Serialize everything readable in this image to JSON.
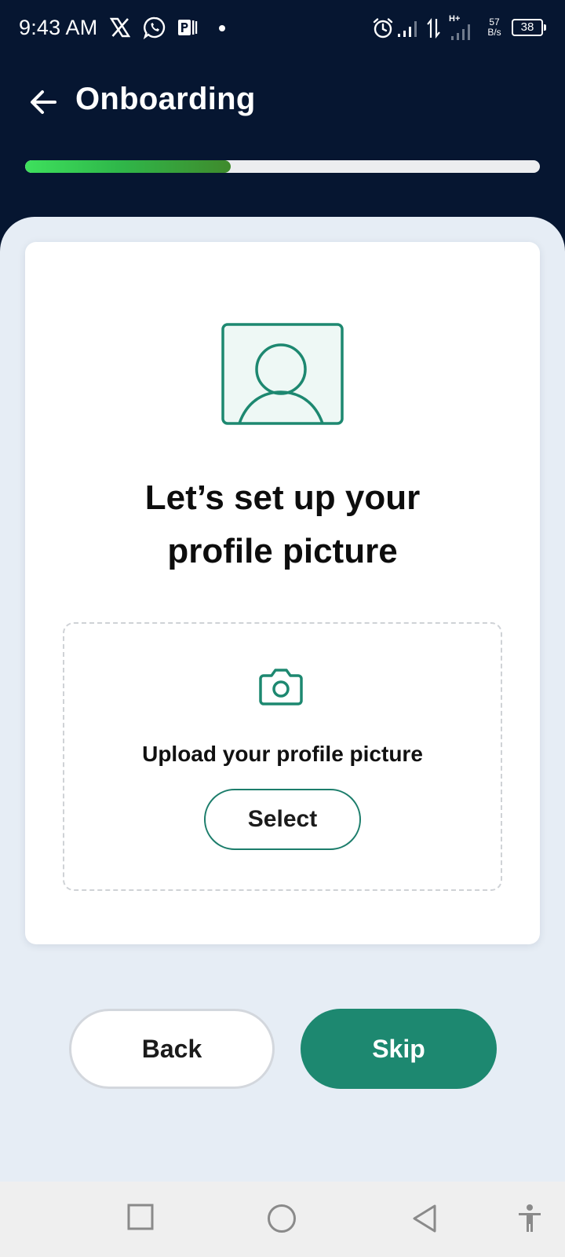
{
  "status_bar": {
    "time": "9:43 AM",
    "net_speed_value": "57",
    "net_speed_unit": "B/s",
    "network_type": "H+",
    "battery": "38",
    "icons": [
      "x-app-icon",
      "whatsapp-icon",
      "p-app-icon",
      "dot-icon",
      "alarm-icon",
      "signal-icon",
      "data-arrows-icon",
      "signal-icon-2",
      "battery-icon"
    ]
  },
  "header": {
    "title": "Onboarding",
    "back_icon": "arrow-left-icon"
  },
  "progress": {
    "value": 0.4
  },
  "card": {
    "illustration_icon": "profile-picture-icon",
    "heading_line1": "Let’s set up your",
    "heading_line2": "profile picture",
    "upload": {
      "icon": "camera-icon",
      "label": "Upload your profile picture",
      "select_label": "Select"
    }
  },
  "actions": {
    "back_label": "Back",
    "skip_label": "Skip"
  },
  "nav_bar": {
    "items": [
      "recents-square-icon",
      "home-circle-icon",
      "back-triangle-icon",
      "accessibility-icon"
    ]
  },
  "colors": {
    "header_bg": "#061631",
    "accent": "#1d8870",
    "progress_start": "#3ee05d",
    "progress_end": "#3f8a2c",
    "page_bg": "#e6edf5"
  }
}
